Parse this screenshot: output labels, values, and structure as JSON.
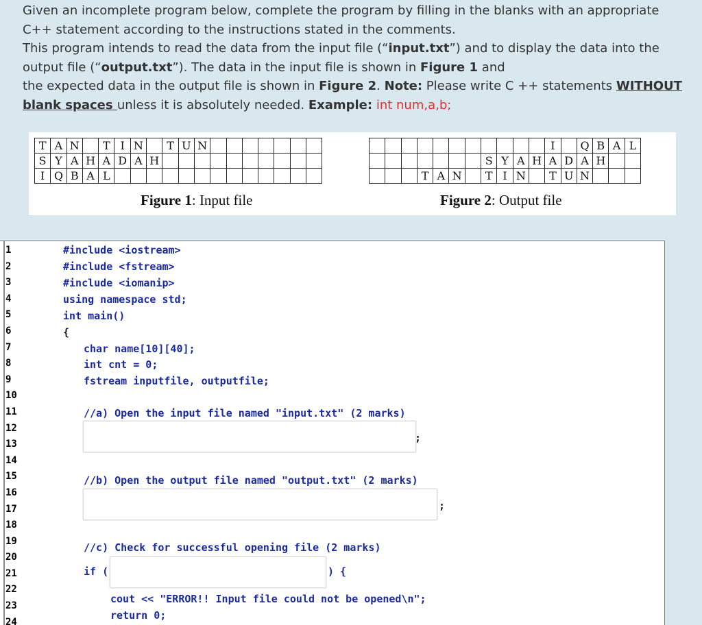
{
  "intro": {
    "l1": "Given an incomplete program below, complete the program by filling in the blanks with an appropriate",
    "l2": "C++ statement according to the instructions stated in the comments.",
    "l3a": "This program intends to read the data from the input file (“",
    "l3b": "input.txt",
    "l3c": "”) and to display the data into the",
    "l4a": "output file (“",
    "l4b": "output.txt",
    "l4c": "”). The data in the input file is shown in ",
    "l4d": "Figure 1",
    "l4e": " and",
    "l5a": "the expected data in the output file is shown in ",
    "l5b": "Figure 2",
    "l5c": ". ",
    "l5d": "Note:",
    "l5e": " Please write C ++ statements ",
    "l5f": "WITHOUT",
    "l6a": "blank spaces ",
    "l6b": "unless it is absolutely needed. ",
    "l6c": "Example:",
    "l6d": " int num,a,b;"
  },
  "figure1": {
    "rows": [
      [
        "T",
        "A",
        "N",
        "",
        "T",
        "I",
        "N",
        "",
        "T",
        "U",
        "N",
        "",
        "",
        "",
        "",
        "",
        "",
        ""
      ],
      [
        "S",
        "Y",
        "A",
        "H",
        "A",
        "D",
        "A",
        "H",
        "",
        "",
        "",
        "",
        "",
        "",
        "",
        "",
        "",
        ""
      ],
      [
        "I",
        "Q",
        "B",
        "A",
        "L",
        "",
        "",
        "",
        "",
        "",
        "",
        "",
        "",
        "",
        "",
        "",
        "",
        ""
      ]
    ],
    "caption_bold": "Figure 1",
    "caption_rest": ": Input file"
  },
  "figure2": {
    "rows": [
      [
        "",
        "",
        "",
        "",
        "",
        "",
        "",
        "",
        "",
        "",
        "",
        "I",
        "",
        "Q",
        "B",
        "A",
        "L"
      ],
      [
        "",
        "",
        "",
        "",
        "",
        "",
        "",
        "S",
        "Y",
        "A",
        "H",
        "A",
        "D",
        "A",
        "H",
        "",
        ""
      ],
      [
        "",
        "",
        "",
        "T",
        "A",
        "N",
        "",
        "T",
        "I",
        "N",
        "",
        "T",
        "U",
        "N",
        "",
        "",
        ""
      ]
    ],
    "caption_bold": "Figure 2",
    "caption_rest": ": Output file"
  },
  "code": {
    "line_numbers": [
      "1",
      "2",
      "3",
      "4",
      "5",
      "6",
      "7",
      "8",
      "9",
      "10",
      "11",
      "12",
      "13",
      "14",
      "15",
      "16",
      "17",
      "18",
      "19",
      "20",
      "21",
      "22",
      "23",
      "24"
    ],
    "l1": "#include <iostream>",
    "l2": "#include <fstream>",
    "l3": "#include <iomanip>",
    "l4": "using namespace std;",
    "l5": "int main()",
    "l6": "{",
    "l7": "char name[10][40];",
    "l8": "int cnt = 0;",
    "l9": "fstream inputfile, outputfile;",
    "c_a": "//a) Open the input file named \"input.txt\" (2 marks)",
    "semi_a": ";",
    "c_b": "//b) Open the output file named \"output.txt\" (2 marks)",
    "semi_b": ";",
    "c_c": "//c) Check for successful opening file (2 marks)",
    "if_open": "if (",
    "if_close": ") {",
    "cout": "cout << \"ERROR!! Input file could not be opened\\n\";",
    "ret": "return 0;"
  }
}
